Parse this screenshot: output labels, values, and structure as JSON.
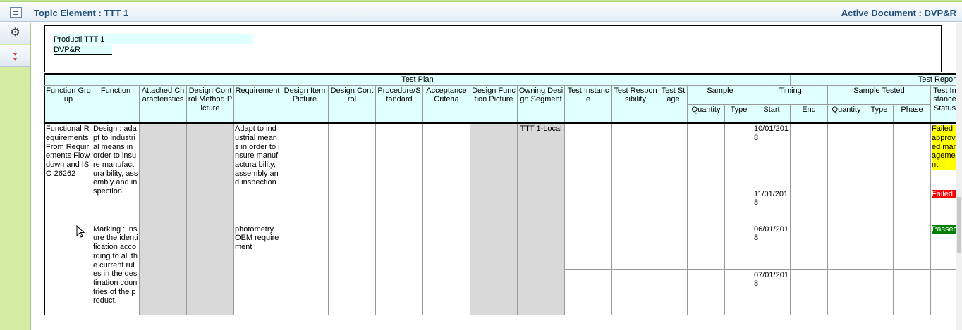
{
  "titlebar": {
    "left": "Topic Element : TTT 1",
    "right": "Active Document : DVP&R"
  },
  "header": {
    "product_label": "Producti",
    "product_value": "TTT 1",
    "doc_label": "DVP&R"
  },
  "groups": {
    "test_plan": "Test Plan",
    "test_report": "Test Report"
  },
  "columns": {
    "function_group": "Function Group",
    "function": "Function",
    "attached_characteristics": "Attached Characteristics",
    "design_control_method_picture": "Design Control Method Picture",
    "requirement": "Requirement",
    "design_item_picture": "Design Item Picture",
    "design_control": "Design Control",
    "procedure_standard": "Procedure/Standard",
    "acceptance_criteria": "Acceptance Criteria",
    "design_function_picture": "Design Function Picture",
    "owning_design_segment": "Owning Design Segment",
    "test_instance": "Test Instance",
    "test_responsibility": "Test Responsibility",
    "test_stage": "Test Stage",
    "sample": "Sample",
    "timing": "Timing",
    "sample_tested": "Sample Tested",
    "test_instance_status": "Test Instance Status",
    "quantity": "Quantity",
    "type": "Type",
    "start": "Start",
    "end": "End",
    "quantity2": "Quantity",
    "type2": "Type",
    "phase": "Phase"
  },
  "rows": {
    "function_group": "Functional Requirements From Requirements Flowdown and ISO 26262",
    "function1": "Design : adapt to industrial means in order to insure manufactura bility, assembly and inspection",
    "requirement1": "Adapt to industrial means in order to insure manufactura bility, assembly and inspection",
    "owning_segment": "TTT 1-Local",
    "function2": "Marking : insure the identification according to all the current rules in the destination countries of the product.",
    "requirement2": "photometry OEM requirement",
    "start1": "10/01/2018",
    "start2": "11/01/2018",
    "start3": "06/01/2018",
    "start4": "07/01/2018",
    "status1": "Failed approved management",
    "status2": "Failed",
    "status3": "Passed"
  },
  "colors": {
    "header_bg": "#e0ffff",
    "grey_cell": "#d9d9d9",
    "failed_approved": "#ffff00",
    "failed": "#ff0000",
    "passed": "#008000"
  },
  "icons": {
    "titlebar": "window-icon",
    "settings": "gear-icon",
    "expand": "double-chevron-down-icon"
  }
}
